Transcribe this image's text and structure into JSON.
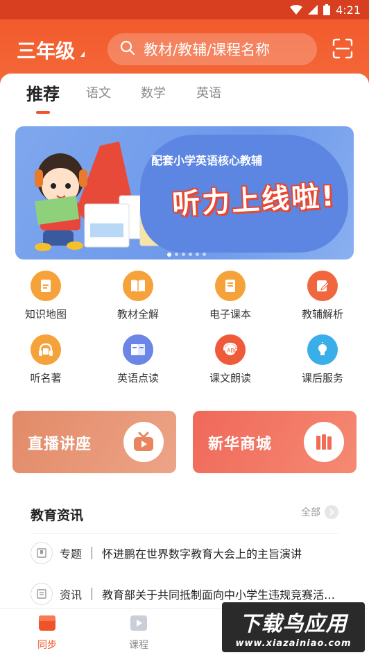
{
  "status_bar": {
    "time": "4:21"
  },
  "header": {
    "grade": "三年级",
    "search_placeholder": "教材/教辅/课程名称"
  },
  "tabs": [
    {
      "label": "推荐",
      "active": true
    },
    {
      "label": "语文",
      "active": false
    },
    {
      "label": "数学",
      "active": false
    },
    {
      "label": "英语",
      "active": false
    }
  ],
  "banner": {
    "subtitle": "配套小学英语核心教辅",
    "headline": "听力上线啦!",
    "slide_count": 6,
    "active_slide": 0
  },
  "grid": [
    {
      "label": "知识地图",
      "icon": "knowledge-map-icon",
      "color": "#f6a23a"
    },
    {
      "label": "教材全解",
      "icon": "textbook-icon",
      "color": "#f6a23a"
    },
    {
      "label": "电子课本",
      "icon": "e-book-icon",
      "color": "#f6a23a"
    },
    {
      "label": "教辅解析",
      "icon": "edit-doc-icon",
      "color": "#f0663f"
    },
    {
      "label": "听名著",
      "icon": "headphones-icon",
      "color": "#f6a23a"
    },
    {
      "label": "英语点读",
      "icon": "english-reading-icon",
      "color": "#6c86e8"
    },
    {
      "label": "课文朗读",
      "icon": "read-aloud-icon",
      "color": "#ef5b3a"
    },
    {
      "label": "课后服务",
      "icon": "lightbulb-icon",
      "color": "#3aaee8"
    }
  ],
  "promos": [
    {
      "label": "直播讲座",
      "icon": "tv-icon",
      "color": "#e8845e"
    },
    {
      "label": "新华商城",
      "icon": "books-icon",
      "color": "#f26b55"
    }
  ],
  "news": {
    "title": "教育资讯",
    "all_label": "全部",
    "items": [
      {
        "category": "专题",
        "icon": "bookmark-icon",
        "text": "怀进鹏在世界数字教育大会上的主旨演讲"
      },
      {
        "category": "资讯",
        "icon": "newspaper-icon",
        "text": "教育部关于共同抵制面向中小学生违规竞赛活动的通知"
      }
    ]
  },
  "bottom_nav": [
    {
      "label": "同步",
      "icon": "book-tab-icon",
      "active": true
    },
    {
      "label": "课程",
      "icon": "play-tab-icon",
      "active": false
    }
  ],
  "watermark": {
    "line1": "下载鸟应用",
    "line2": "www.xiazainiao.com"
  },
  "colors": {
    "brand": "#f25a2c",
    "active_tab": "#f0532a",
    "inactive": "#888888"
  }
}
